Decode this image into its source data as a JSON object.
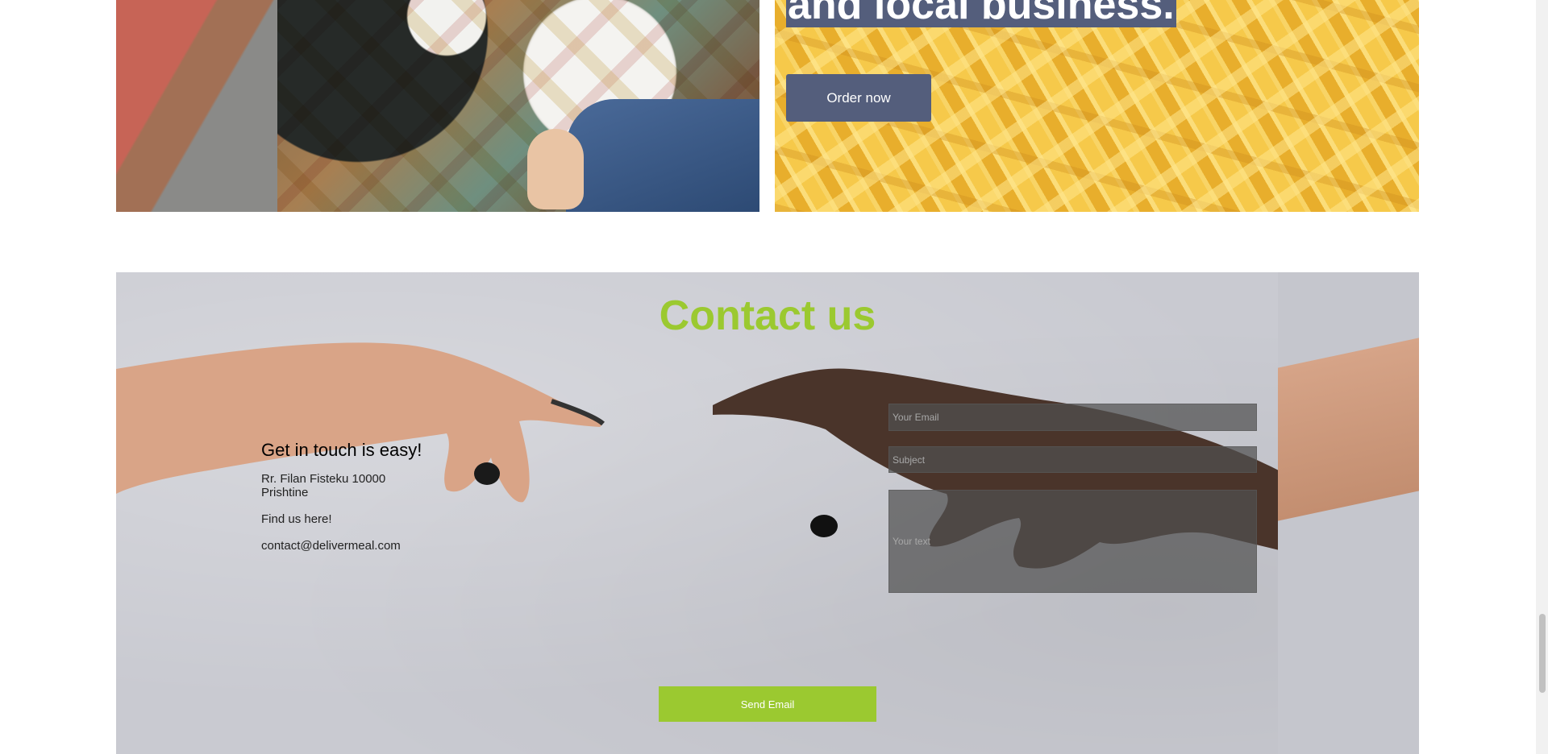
{
  "promo": {
    "headline": "and local business.",
    "order_button": "Order now"
  },
  "contact": {
    "title": "Contact us",
    "info_heading": "Get in touch is easy!",
    "address_line1": "Rr. Filan Fisteku 10000",
    "address_line2": "Prishtine",
    "find_us": "Find us here!",
    "email": "contact@delivermeal.com",
    "form": {
      "email_placeholder": "Your Email",
      "subject_placeholder": "Subject",
      "message_placeholder": "Your text",
      "send_label": "Send Email"
    }
  },
  "colors": {
    "accent_green": "#9bc930",
    "button_slate": "#545e7c"
  }
}
